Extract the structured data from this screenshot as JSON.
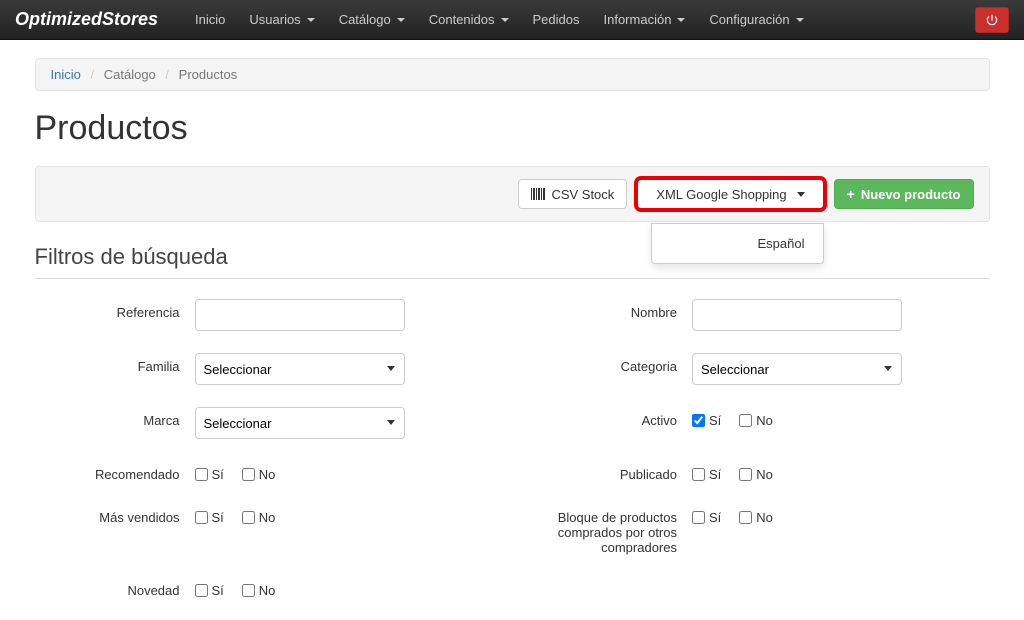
{
  "brand": "OptimizedStores",
  "nav": {
    "items": [
      {
        "label": "Inicio",
        "caret": false
      },
      {
        "label": "Usuarios",
        "caret": true
      },
      {
        "label": "Catálogo",
        "caret": true
      },
      {
        "label": "Contenidos",
        "caret": true
      },
      {
        "label": "Pedidos",
        "caret": false
      },
      {
        "label": "Información",
        "caret": true
      },
      {
        "label": "Configuración",
        "caret": true
      }
    ]
  },
  "breadcrumb": {
    "home": "Inicio",
    "cat": "Catálogo",
    "current": "Productos"
  },
  "page_title": "Productos",
  "toolbar": {
    "csv": "CSV Stock",
    "xml": "XML Google Shopping",
    "new": "Nuevo producto",
    "dropdown_item": "Español"
  },
  "filters": {
    "heading": "Filtros de búsqueda",
    "select_placeholder": "Seleccionar",
    "yes": "Sí",
    "no": "No",
    "labels": {
      "referencia": "Referencia",
      "nombre": "Nombre",
      "familia": "Familia",
      "categoria": "Categoria",
      "marca": "Marca",
      "activo": "Activo",
      "recomendado": "Recomendado",
      "publicado": "Publicado",
      "mas_vendidos": "Más vendidos",
      "bloque": "Bloque de productos comprados por otros compradores",
      "novedad": "Novedad"
    }
  }
}
